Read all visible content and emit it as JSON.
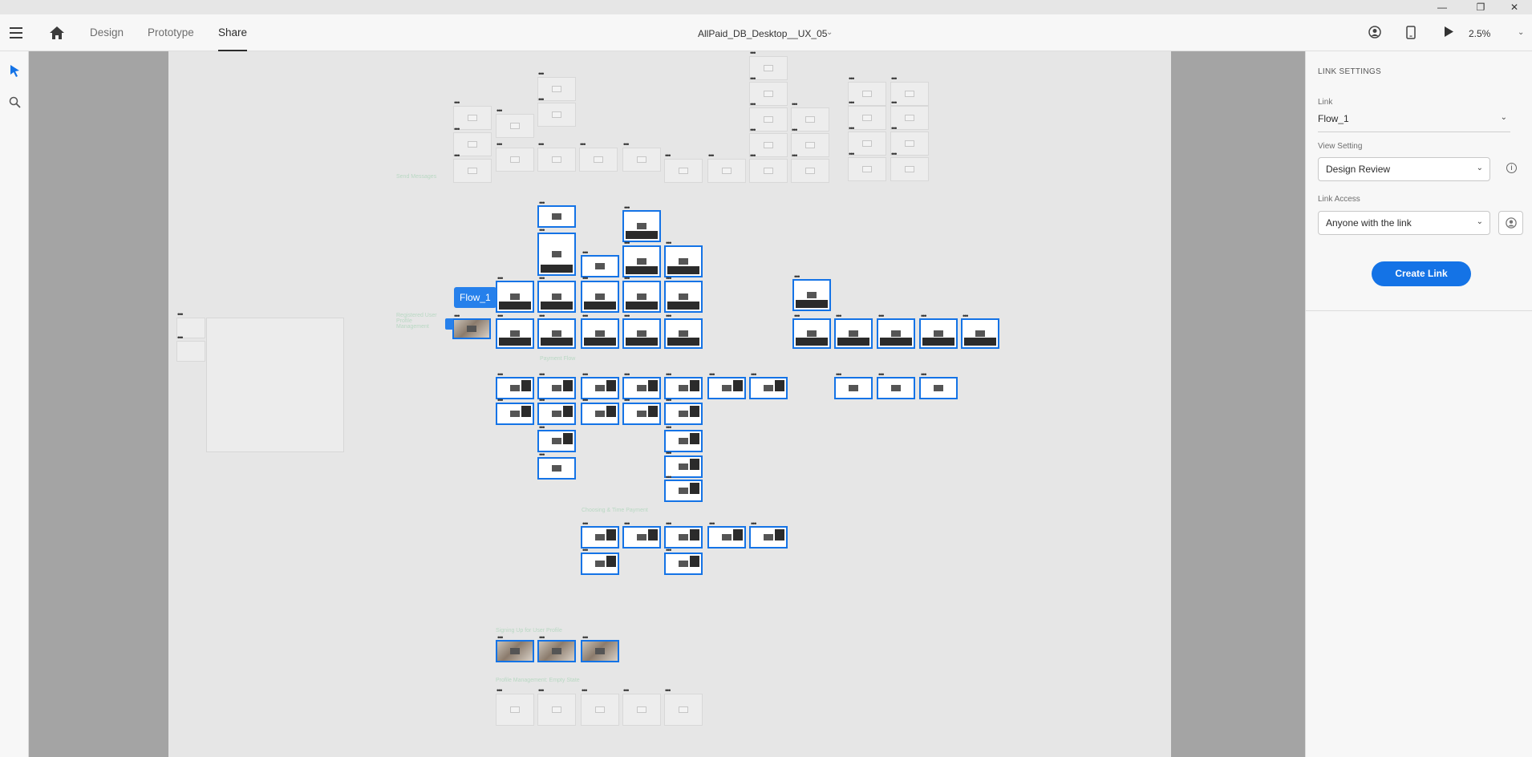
{
  "app": {
    "document_title": "AllPaid_DB_Desktop__UX_05",
    "tabs": [
      {
        "label": "Design"
      },
      {
        "label": "Prototype"
      },
      {
        "label": "Share"
      }
    ],
    "active_tab": "Share",
    "zoom": "2.5%"
  },
  "icons": {
    "menu": "hamburger-icon",
    "home": "home-icon",
    "select_tool": "arrow-select-icon",
    "zoom_tool": "search-icon",
    "user": "user-avatar-icon",
    "device": "mobile-device-icon",
    "play": "play-icon",
    "minimize": "minimize-icon",
    "restore": "restore-icon",
    "close": "close-icon"
  },
  "canvas": {
    "flow_badge": "Flow_1",
    "sections": [
      "Send Messages",
      "Registered User Profile Management",
      "Payment Flow",
      "Choosing & Time Payment",
      "Signing Up for User Profile",
      "Profile Management: Empty State"
    ]
  },
  "link_settings": {
    "header": "LINK SETTINGS",
    "link_label": "Link",
    "link_value": "Flow_1",
    "view_setting_label": "View Setting",
    "view_setting_value": "Design Review",
    "link_access_label": "Link Access",
    "link_access_value": "Anyone with the link",
    "create_button": "Create Link"
  },
  "colors": {
    "accent": "#1473e6",
    "badge": "#2680eb",
    "canvas_dark": "#a4a4a4",
    "artboard_area": "#e6e6e6"
  }
}
